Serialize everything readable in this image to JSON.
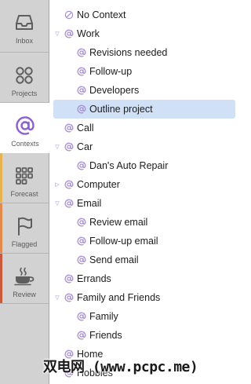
{
  "sidebar": {
    "perspectives": [
      {
        "label": "Inbox",
        "icon": "inbox-icon",
        "selected": false
      },
      {
        "label": "Projects",
        "icon": "projects-icon",
        "selected": false
      },
      {
        "label": "Contexts",
        "icon": "contexts-icon",
        "selected": true
      },
      {
        "label": "Forecast",
        "icon": "forecast-icon",
        "selected": false
      },
      {
        "label": "Flagged",
        "icon": "flagged-icon",
        "selected": false
      },
      {
        "label": "Review",
        "icon": "review-icon",
        "selected": false
      }
    ],
    "accent_colors": {
      "contexts": "#8b5fd1",
      "forecast": "#e7b450",
      "flagged": "#e28a4a",
      "review": "#c9593a"
    }
  },
  "outline": {
    "items": [
      {
        "label": "No Context",
        "level": 0,
        "expander": "none",
        "icon": "no-context-icon"
      },
      {
        "label": "Work",
        "level": 0,
        "expander": "expanded",
        "icon": "at-icon"
      },
      {
        "label": "Revisions needed",
        "level": 1,
        "expander": "none",
        "icon": "at-icon"
      },
      {
        "label": "Follow-up",
        "level": 1,
        "expander": "none",
        "icon": "at-icon"
      },
      {
        "label": "Developers",
        "level": 1,
        "expander": "none",
        "icon": "at-icon"
      },
      {
        "label": "Outline project",
        "level": 1,
        "expander": "none",
        "icon": "at-icon",
        "selected": true
      },
      {
        "label": "Call",
        "level": 0,
        "expander": "none",
        "icon": "at-icon"
      },
      {
        "label": "Car",
        "level": 0,
        "expander": "expanded",
        "icon": "at-icon"
      },
      {
        "label": "Dan's Auto Repair",
        "level": 1,
        "expander": "none",
        "icon": "at-icon"
      },
      {
        "label": "Computer",
        "level": 0,
        "expander": "collapsed",
        "icon": "at-icon"
      },
      {
        "label": "Email",
        "level": 0,
        "expander": "expanded",
        "icon": "at-icon"
      },
      {
        "label": "Review email",
        "level": 1,
        "expander": "none",
        "icon": "at-icon"
      },
      {
        "label": "Follow-up email",
        "level": 1,
        "expander": "none",
        "icon": "at-icon"
      },
      {
        "label": "Send email",
        "level": 1,
        "expander": "none",
        "icon": "at-icon"
      },
      {
        "label": "Errands",
        "level": 0,
        "expander": "none",
        "icon": "at-icon"
      },
      {
        "label": "Family and Friends",
        "level": 0,
        "expander": "expanded",
        "icon": "at-icon"
      },
      {
        "label": "Family",
        "level": 1,
        "expander": "none",
        "icon": "at-icon"
      },
      {
        "label": "Friends",
        "level": 1,
        "expander": "none",
        "icon": "at-icon"
      },
      {
        "label": "Home",
        "level": 0,
        "expander": "none",
        "icon": "at-icon"
      },
      {
        "label": "Hobbies",
        "level": 0,
        "expander": "none",
        "icon": "at-icon"
      }
    ],
    "colors": {
      "at_icon": "#a88fd6",
      "expander": "#9a86c8",
      "selection": "#cfe0f7"
    }
  },
  "watermark": "双电网 (www.pcpc.me)"
}
